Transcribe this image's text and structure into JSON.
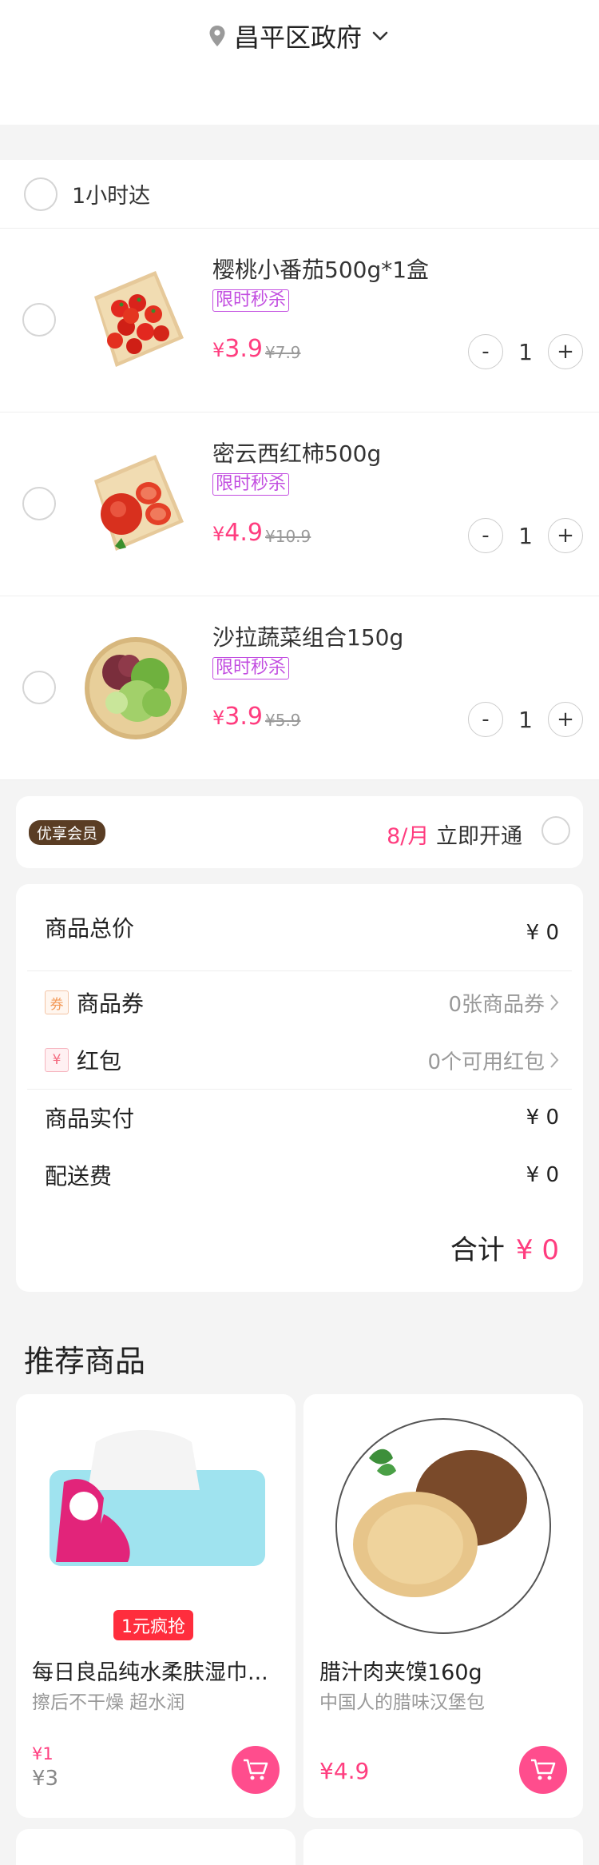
{
  "header": {
    "location": "昌平区政府"
  },
  "cart": {
    "group_label": "1小时达",
    "items": [
      {
        "name": "樱桃小番茄500g*1盒",
        "tag": "限时秒杀",
        "currency": "¥",
        "price": "3.9",
        "original_price": "¥7.9",
        "qty": "1"
      },
      {
        "name": "密云西红柿500g",
        "tag": "限时秒杀",
        "currency": "¥",
        "price": "4.9",
        "original_price": "¥10.9",
        "qty": "1"
      },
      {
        "name": "沙拉蔬菜组合150g",
        "tag": "限时秒杀",
        "currency": "¥",
        "price": "3.9",
        "original_price": "¥5.9",
        "qty": "1"
      }
    ],
    "minus_label": "-",
    "plus_label": "+"
  },
  "member": {
    "badge": "优享会员",
    "price": "8/月",
    "action": "立即开通"
  },
  "summary": {
    "goods_total_label": "商品总价",
    "goods_total_value": "¥ 0",
    "coupon_icon": "券",
    "coupon_label": "商品券",
    "coupon_value": "0张商品券",
    "redpacket_icon": "¥",
    "redpacket_label": "红包",
    "redpacket_value": "0个可用红包",
    "paid_label": "商品实付",
    "paid_value": "¥ 0",
    "delivery_label": "配送费",
    "delivery_value": "¥ 0",
    "total_label": "合计",
    "total_value": "¥ 0"
  },
  "recommend": {
    "title": "推荐商品",
    "products": [
      {
        "promo": "1元疯抢",
        "name": "每日良品纯水柔肤湿巾...",
        "desc": "擦后不干燥 超水润",
        "promo_price": "¥1",
        "price": "¥3"
      },
      {
        "name": "腊汁肉夹馍160g",
        "desc": "中国人的腊味汉堡包",
        "price": "¥4.9"
      }
    ]
  },
  "colors": {
    "accent": "#ff3d7f",
    "tag": "#c24de0",
    "promo_red": "#ff2d3d",
    "member_badge": "#5a3d24"
  }
}
